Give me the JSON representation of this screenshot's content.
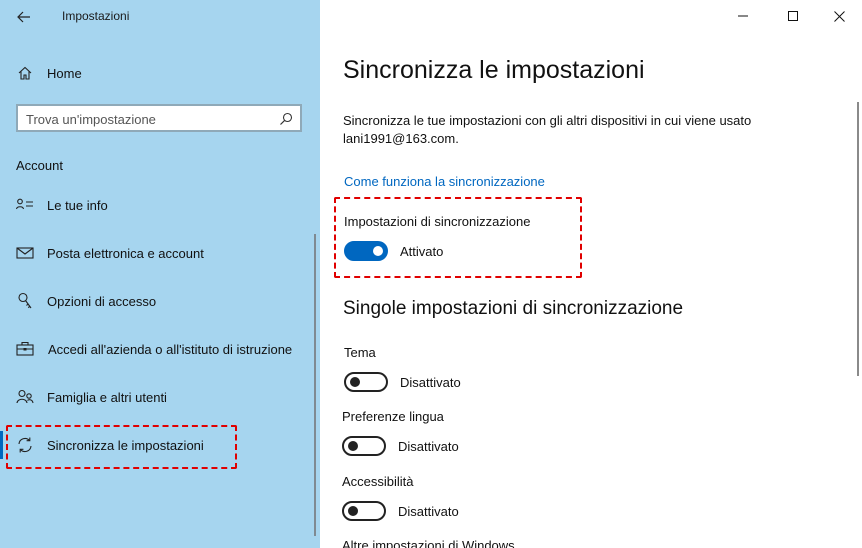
{
  "window": {
    "title": "Impostazioni",
    "minimize_icon": "minimize-icon",
    "maximize_icon": "maximize-icon",
    "close_icon": "close-icon"
  },
  "sidebar": {
    "home_label": "Home",
    "search_placeholder": "Trova un'impostazione",
    "section_heading": "Account",
    "items": [
      {
        "label": "Le tue info",
        "icon": "person-info-icon"
      },
      {
        "label": "Posta elettronica e account",
        "icon": "mail-icon"
      },
      {
        "label": "Opzioni di accesso",
        "icon": "key-icon"
      },
      {
        "label": "Accedi all'azienda o all'istituto di istruzione",
        "icon": "briefcase-icon"
      },
      {
        "label": "Famiglia e altri utenti",
        "icon": "people-icon"
      },
      {
        "label": "Sincronizza le impostazioni",
        "icon": "sync-icon",
        "selected": true
      }
    ]
  },
  "main": {
    "title": "Sincronizza le impostazioni",
    "description": "Sincronizza le tue impostazioni con gli altri dispositivi in cui viene usato lani1991@163.com.",
    "link": "Come funziona la sincronizzazione",
    "sync_settings": {
      "label": "Impostazioni di sincronizzazione",
      "state": "Attivato",
      "on": true
    },
    "individual_heading": "Singole impostazioni di sincronizzazione",
    "individual": [
      {
        "label": "Tema",
        "state": "Disattivato",
        "on": false
      },
      {
        "label": "Preferenze lingua",
        "state": "Disattivato",
        "on": false
      },
      {
        "label": "Accessibilità",
        "state": "Disattivato",
        "on": false
      }
    ],
    "partial_item_label": "Altre impostazioni di Windows"
  },
  "colors": {
    "sidebar_bg": "#a6d5ef",
    "accent": "#0067c0",
    "highlight_border": "#e00000"
  }
}
